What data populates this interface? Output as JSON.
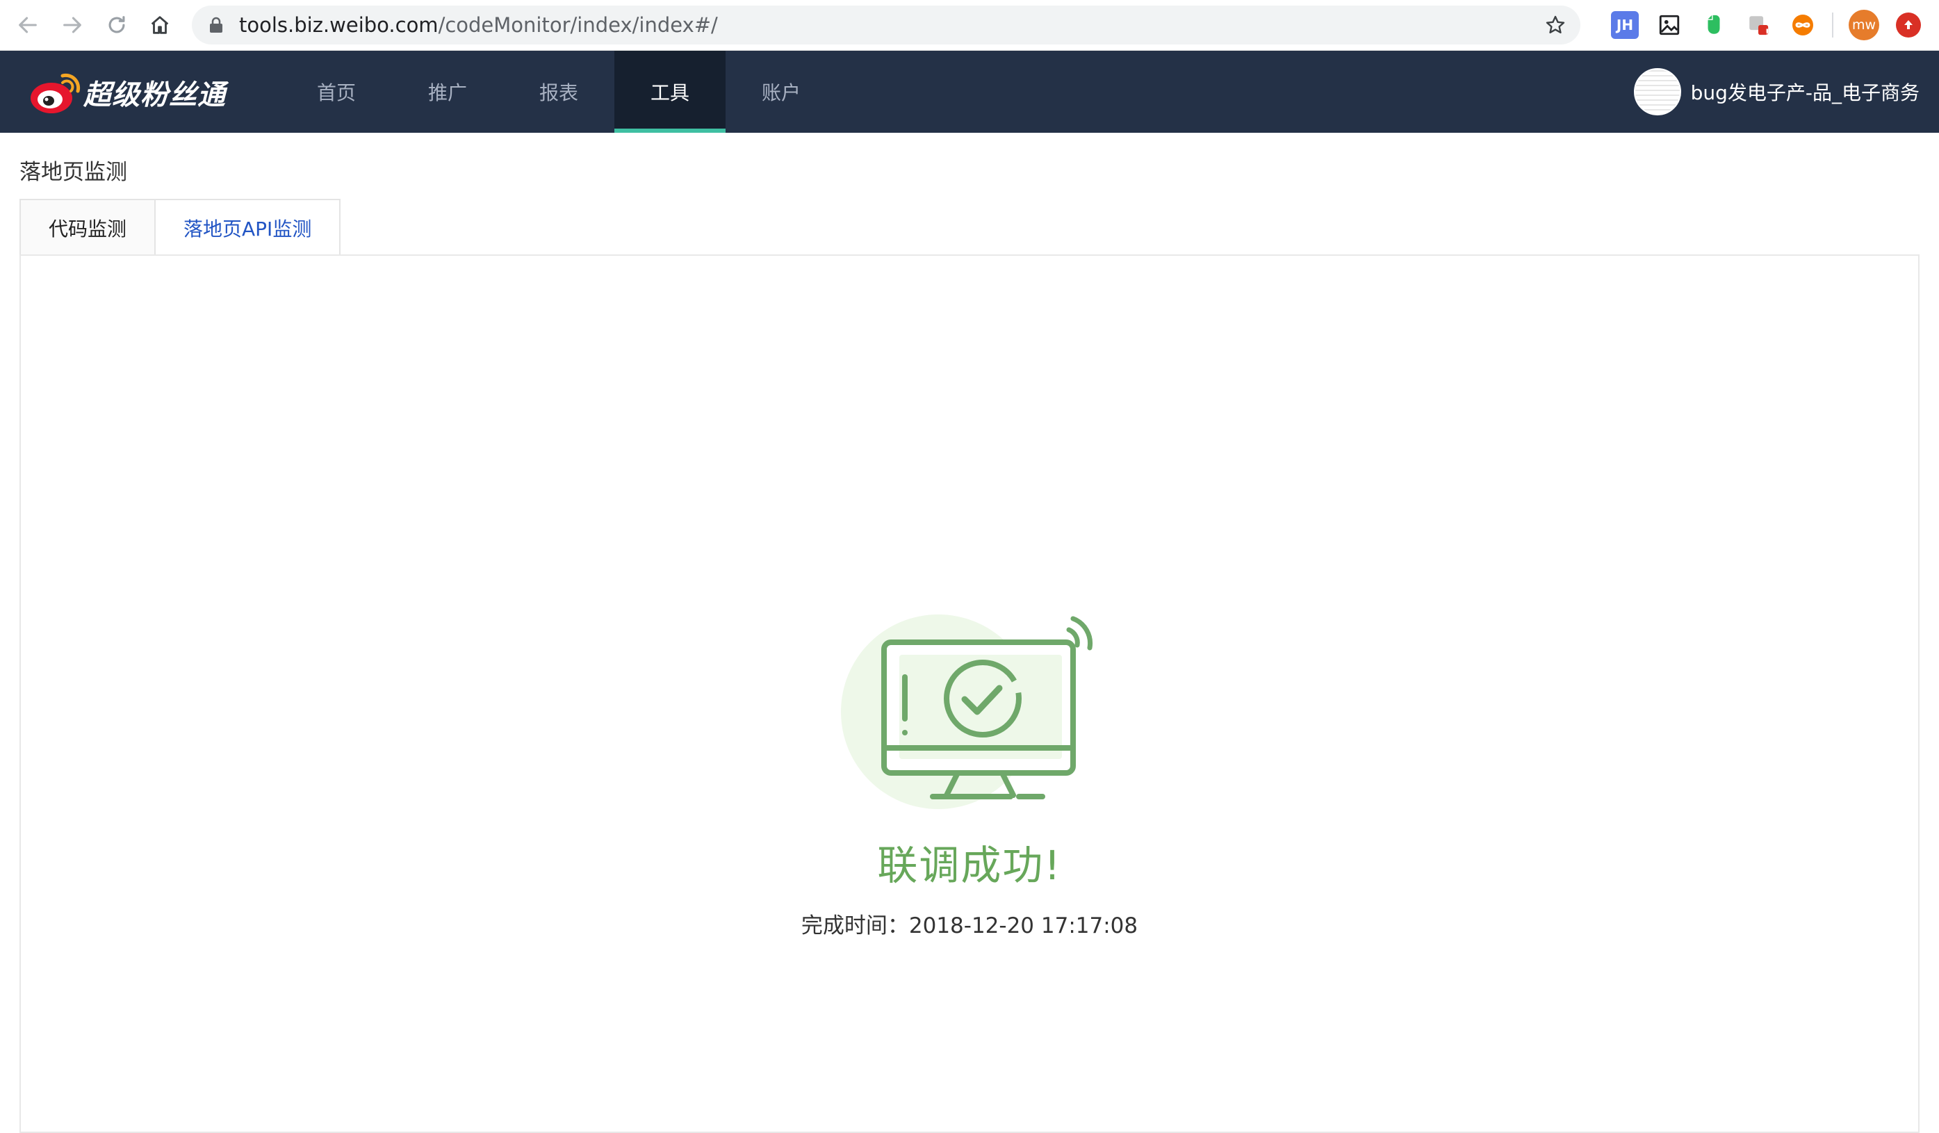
{
  "browser": {
    "url_host": "tools.biz.weibo.com",
    "url_path": "/codeMonitor/index/index#/",
    "extensions": [
      {
        "name": "jh-extension-icon",
        "label": "JH",
        "color": "#5b7be8"
      },
      {
        "name": "image-extension-icon",
        "label": "",
        "color": "#ffffff"
      },
      {
        "name": "evernote-icon",
        "label": "",
        "color": "#ffffff"
      },
      {
        "name": "puzzle-extension-icon",
        "label": "!",
        "color": "#e53935"
      },
      {
        "name": "infinity-extension-icon",
        "label": "∞",
        "color": "#f57c00"
      },
      {
        "name": "profile-avatar-icon",
        "label": "mw",
        "color": "#e67c2b"
      },
      {
        "name": "upload-extension-icon",
        "label": "",
        "color": "#d93025"
      }
    ]
  },
  "navbar": {
    "logo_text": "超级粉丝通",
    "items": [
      {
        "label": "首页"
      },
      {
        "label": "推广"
      },
      {
        "label": "报表"
      },
      {
        "label": "工具"
      },
      {
        "label": "账户"
      }
    ],
    "active_index": 3,
    "user_name": "bug发电子产-品_电子商务"
  },
  "page": {
    "title": "落地页监测",
    "tabs": [
      {
        "label": "代码监测"
      },
      {
        "label": "落地页API监测"
      }
    ]
  },
  "result": {
    "title": "联调成功!",
    "finish_label": "完成时间：",
    "finish_time": "2018-12-20 17:17:08"
  },
  "colors": {
    "navbar_bg": "#243147",
    "active_underline": "#3fbfa2",
    "success_green": "#67a75a",
    "tab_link_blue": "#2255c4"
  }
}
